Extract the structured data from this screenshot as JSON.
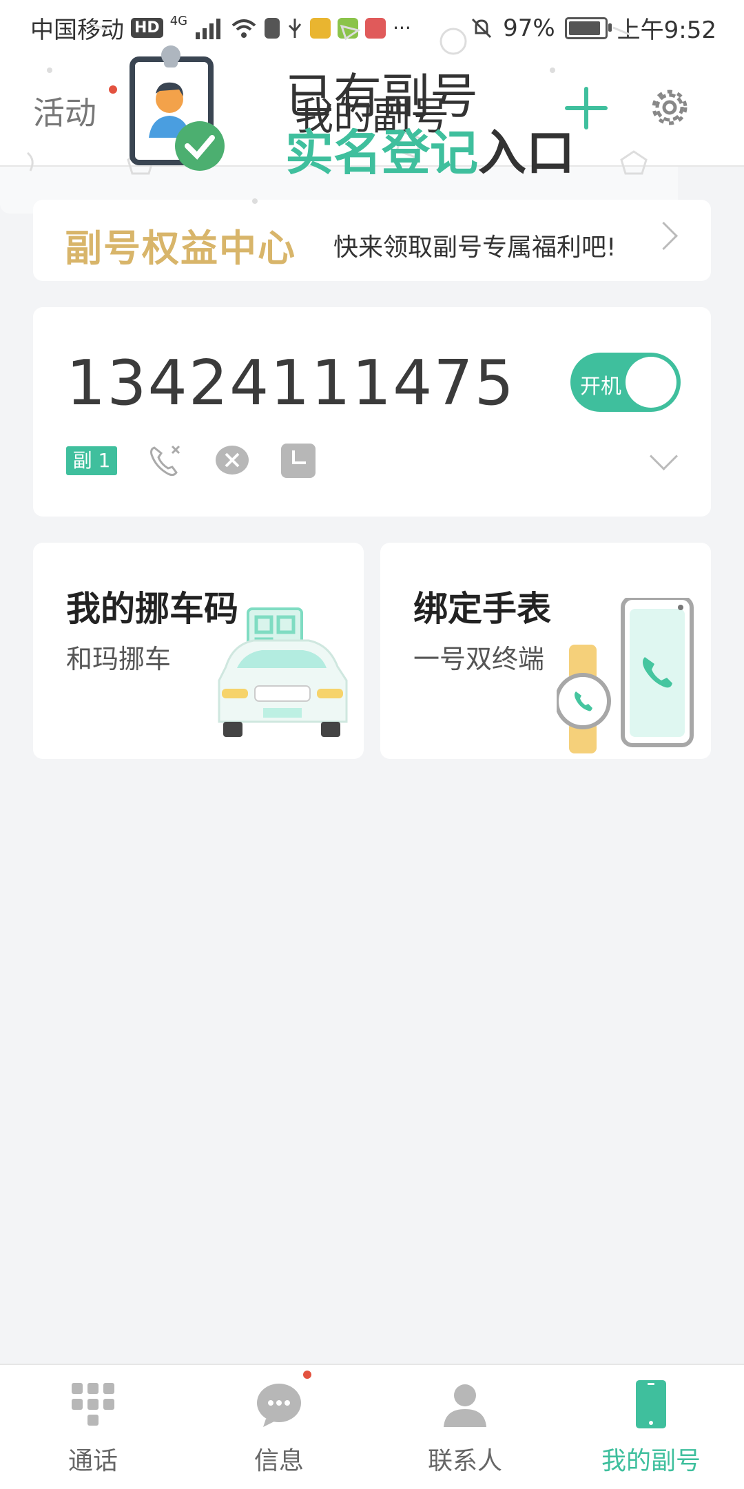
{
  "status_bar": {
    "carrier": "中国移动",
    "hd": "HD",
    "network": "4G",
    "battery": "97%",
    "time": "上午9:52"
  },
  "header": {
    "activity": "活动",
    "title": "我的副号"
  },
  "benefit": {
    "logo_text": "副号权益中心",
    "text": "快来领取副号专属福利吧!"
  },
  "number_card": {
    "number": "13424111475",
    "toggle_label": "开机",
    "toggle_on": true,
    "sub_badge": "副 1"
  },
  "features": [
    {
      "title": "我的挪车码",
      "subtitle": "和玛挪车"
    },
    {
      "title": "绑定手表",
      "subtitle": "一号双终端"
    }
  ],
  "realname": {
    "line1": "已有副号",
    "line2_accent": "实名登记",
    "line2_plain": "入口"
  },
  "bottom_nav": [
    {
      "label": "通话",
      "icon": "dialpad-icon"
    },
    {
      "label": "信息",
      "icon": "message-icon"
    },
    {
      "label": "联系人",
      "icon": "contact-icon"
    },
    {
      "label": "我的副号",
      "icon": "phone-icon"
    }
  ],
  "colors": {
    "accent": "#3fbf9d",
    "gold": "#d8b56a",
    "dot": "#e3523f"
  }
}
